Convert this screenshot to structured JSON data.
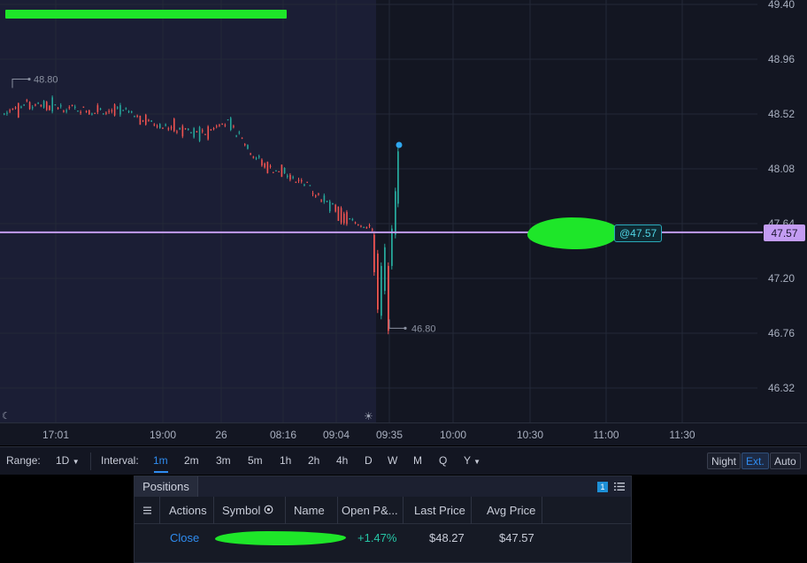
{
  "chart": {
    "price_axis_labels": [
      "49.40",
      "48.96",
      "48.52",
      "48.08",
      "47.64",
      "47.20",
      "46.76",
      "46.32"
    ],
    "time_axis_labels": [
      "17:01",
      "19:00",
      "26",
      "08:16",
      "09:04",
      "09:35",
      "10:00",
      "10:30",
      "11:00",
      "11:30"
    ],
    "current_price": "47.57",
    "order_tag": "@47.57",
    "high_marker": "48.80",
    "low_marker": "46.80",
    "colors": {
      "background": "#131622",
      "extended_hours_bg": "#1b1e35",
      "up_candle": "#26a69a",
      "down_candle": "#ef5350",
      "price_line": "#c39cf3"
    }
  },
  "toolbar": {
    "range_label": "Range:",
    "range_value": "1D",
    "interval_label": "Interval:",
    "intervals": [
      "1m",
      "2m",
      "3m",
      "5m",
      "1h",
      "2h",
      "4h",
      "D",
      "W",
      "M",
      "Q",
      "Y"
    ],
    "active_interval": "1m",
    "session_modes": [
      "Night",
      "Ext.",
      "Auto"
    ],
    "active_session_mode": "Ext."
  },
  "positions": {
    "tab_label": "Positions",
    "count": "1",
    "columns": [
      "Actions",
      "Symbol",
      "Name",
      "Open P&...",
      "Last Price",
      "Avg Price"
    ],
    "rows": [
      {
        "action": "Close",
        "open_pnl": "+1.47%",
        "last_price": "$48.27",
        "avg_price": "$47.57"
      }
    ]
  }
}
